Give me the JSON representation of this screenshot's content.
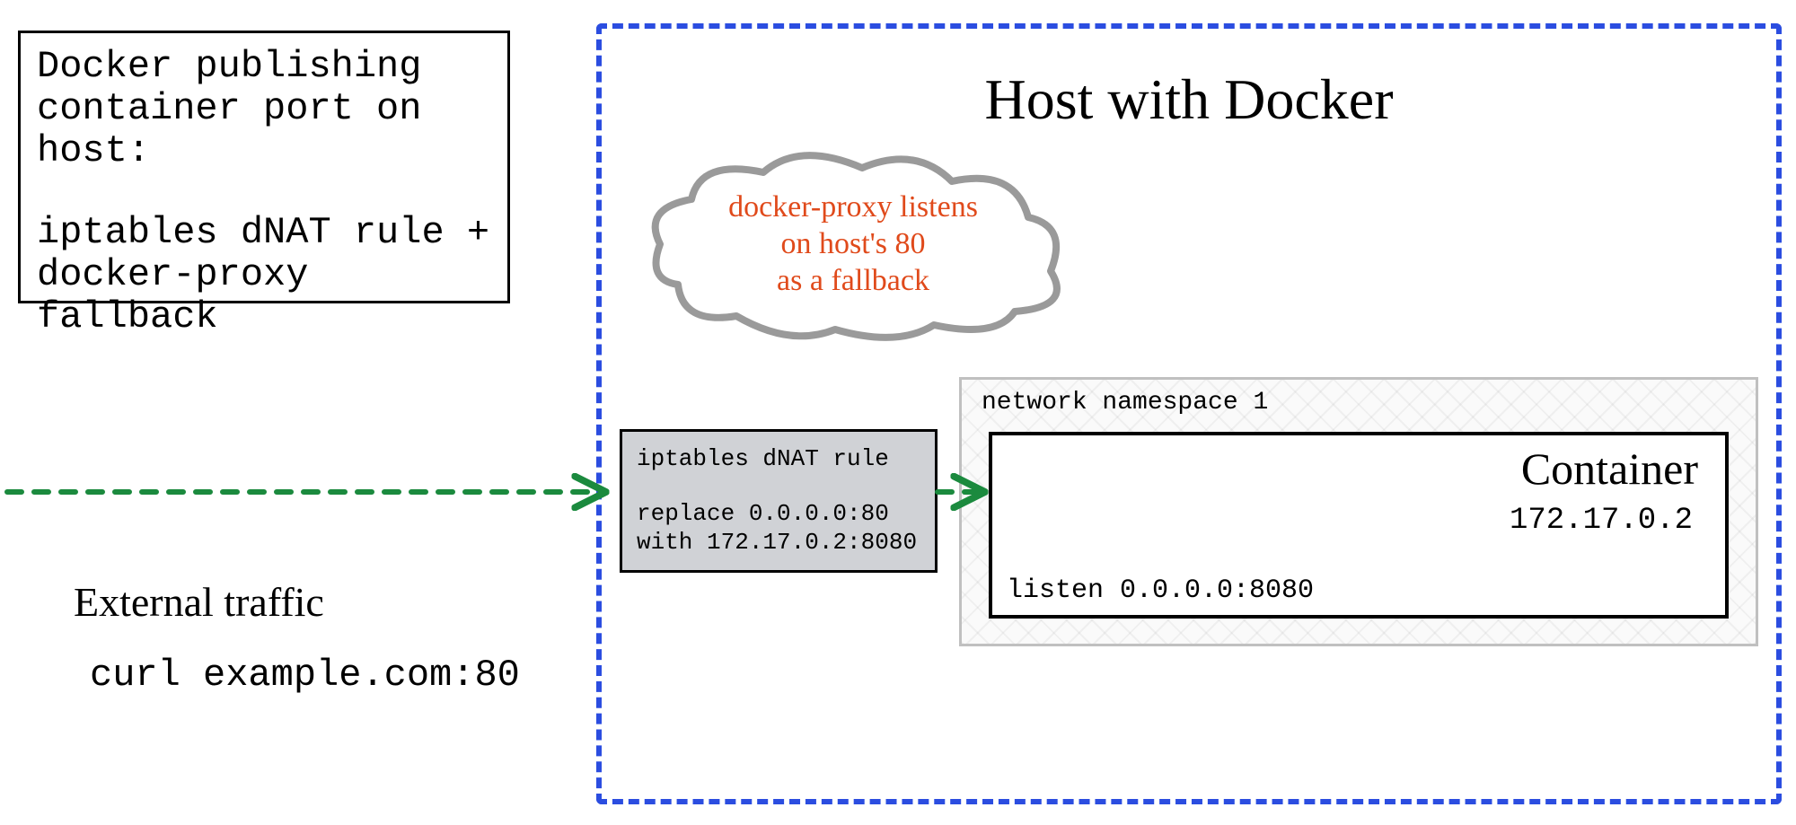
{
  "title_box": {
    "line1": "Docker publishing",
    "line2": "container port on",
    "line3": "host:",
    "line4": "iptables dNAT rule +",
    "line5": "docker-proxy fallback"
  },
  "external_traffic": {
    "label": "External traffic",
    "command": "curl example.com:80"
  },
  "host": {
    "title": "Host with Docker"
  },
  "cloud": {
    "line1": "docker-proxy listens",
    "line2": "on host's 80",
    "line3": "as a fallback"
  },
  "iptables": {
    "heading": "iptables dNAT rule",
    "replace_line": "replace 0.0.0.0:80",
    "with_line": "with 172.17.0.2:8080"
  },
  "namespace": {
    "label": "network namespace 1"
  },
  "container": {
    "title": "Container",
    "ip": "172.17.0.2",
    "listen": "listen 0.0.0.0:8080"
  },
  "colors": {
    "arrow_green": "#1b8a3e",
    "host_border": "#2b4de0",
    "cloud_stroke": "#9a9a9a",
    "cloud_text": "#e04a1b"
  }
}
